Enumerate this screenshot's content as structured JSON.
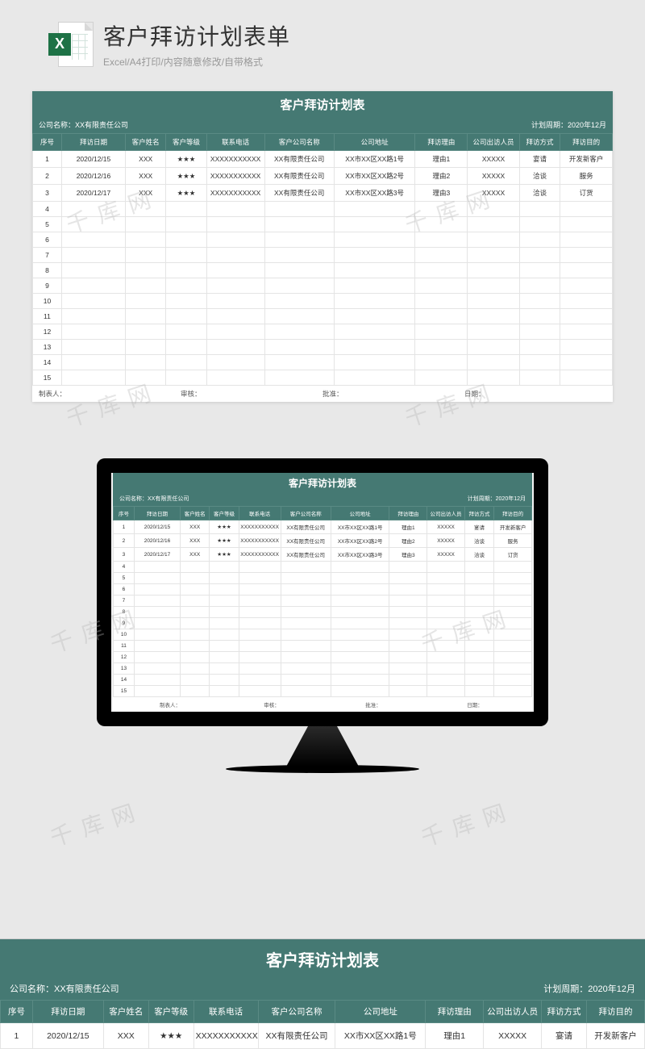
{
  "header": {
    "title": "客户拜访计划表单",
    "subtitle": "Excel/A4打印/内容随意修改/自带格式",
    "icon_letter": "X"
  },
  "sheet": {
    "title": "客户拜访计划表",
    "company_label": "公司名称：",
    "company_value": "XX有限责任公司",
    "period_label": "计划周期：",
    "period_value": "2020年12月",
    "columns": [
      "序号",
      "拜访日期",
      "客户姓名",
      "客户等级",
      "联系电话",
      "客户公司名称",
      "公司地址",
      "拜访理由",
      "公司出访人员",
      "拜访方式",
      "拜访目的"
    ],
    "rows": [
      {
        "seq": "1",
        "date": "2020/12/15",
        "name": "XXX",
        "level": "★★★",
        "phone": "XXXXXXXXXXX",
        "cname": "XX有限责任公司",
        "addr": "XX市XX区XX路1号",
        "reason": "理由1",
        "person": "XXXXX",
        "method": "宴请",
        "purpose": "开发新客户"
      },
      {
        "seq": "2",
        "date": "2020/12/16",
        "name": "XXX",
        "level": "★★★",
        "phone": "XXXXXXXXXXX",
        "cname": "XX有限责任公司",
        "addr": "XX市XX区XX路2号",
        "reason": "理由2",
        "person": "XXXXX",
        "method": "洽谈",
        "purpose": "服务"
      },
      {
        "seq": "3",
        "date": "2020/12/17",
        "name": "XXX",
        "level": "★★★",
        "phone": "XXXXXXXXXXX",
        "cname": "XX有限责任公司",
        "addr": "XX市XX区XX路3号",
        "reason": "理由3",
        "person": "XXXXX",
        "method": "洽谈",
        "purpose": "订货"
      }
    ],
    "empty_rows": [
      "4",
      "5",
      "6",
      "7",
      "8",
      "9",
      "10",
      "11",
      "12",
      "13",
      "14",
      "15"
    ],
    "footer": {
      "maker": "制表人：",
      "checker": "审核：",
      "approver": "批准：",
      "date": "日期："
    }
  },
  "bottom_row": {
    "seq": "1",
    "date": "2020/12/15",
    "name": "XXX",
    "level": "★★★",
    "phone": "XXXXXXXXXXX",
    "cname": "XX有限责任公司",
    "addr": "XX市XX区XX路1号",
    "reason": "理由1",
    "person": "XXXXX",
    "method": "宴请",
    "purpose": "开发新客户"
  },
  "watermark": "千库网"
}
